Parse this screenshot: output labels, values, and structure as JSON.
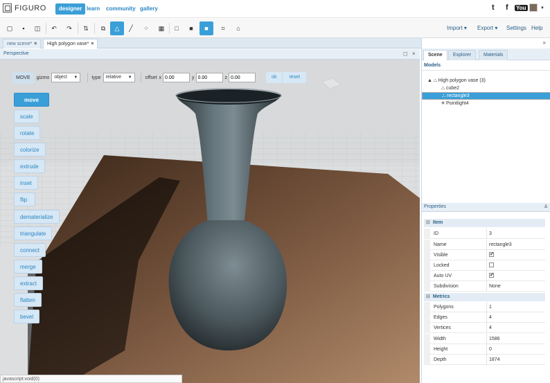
{
  "app": {
    "logo_text": "FIGURO",
    "nav": [
      {
        "label": "designer",
        "active": true
      },
      {
        "label": "learn",
        "active": false
      },
      {
        "label": "community",
        "active": false
      },
      {
        "label": "gallery",
        "active": false
      }
    ],
    "social": {
      "twitter": "t",
      "facebook": "f",
      "youtube": "You"
    }
  },
  "toolbar": {
    "tools": [
      "new-icon",
      "save-icon",
      "save-as-icon",
      "undo-icon",
      "redo-icon",
      "align-icon",
      "clone-icon",
      "vertex-mode-icon",
      "edge-mode-icon",
      "face-mode-icon",
      "checker-icon",
      "box-icon",
      "solid-icon",
      "fill-icon",
      "crop-icon",
      "render-icon"
    ],
    "menus": {
      "import": "Import",
      "export": "Export",
      "settings": "Settings",
      "help": "Help"
    }
  },
  "tabs": [
    {
      "label": "new scene*",
      "close": "×"
    },
    {
      "label": "High polygon vase*",
      "close": "×"
    }
  ],
  "perspective": {
    "title": "Perspective",
    "movebar": {
      "mode": "MOVE",
      "gizmo_label": "gizmo",
      "gizmo_value": "object",
      "type_label": "type",
      "type_value": "relative",
      "offset_label": "offset",
      "x_label": "x",
      "x_value": "0.00",
      "y_label": "y",
      "y_value": "0.00",
      "z_label": "z",
      "z_value": "0.00",
      "ok": "ok",
      "reset": "reset"
    },
    "tools": [
      "move",
      "scale",
      "rotate",
      "colorize",
      "extrude",
      "inset",
      "flip",
      "dematerialize",
      "triangulate",
      "connect",
      "merge",
      "extract",
      "flatten",
      "bevel"
    ]
  },
  "status": "javascript:void(0)",
  "right_panel": {
    "tabs": [
      "Scene",
      "Explorer",
      "Materials"
    ],
    "models_title": "Models",
    "tree": [
      {
        "label": "High polygon vase (3)",
        "icon": "▲ ⛬"
      },
      {
        "label": "cube2",
        "icon": "⛬"
      },
      {
        "label": "rectangle3",
        "icon": "⛬"
      },
      {
        "label": "Pointlight4",
        "icon": "✳"
      }
    ],
    "properties_title": "Properties",
    "item_group": "Item",
    "metrics_group": "Metrics",
    "props": {
      "id": {
        "k": "ID",
        "v": "3"
      },
      "name": {
        "k": "Name",
        "v": "rectangle3"
      },
      "visible": {
        "k": "Visible",
        "v": "✔"
      },
      "locked": {
        "k": "Locked",
        "v": ""
      },
      "autouv": {
        "k": "Auto UV",
        "v": "✔"
      },
      "subdivision": {
        "k": "Subdivision",
        "v": "None"
      },
      "polygons": {
        "k": "Polygons",
        "v": "1"
      },
      "edges": {
        "k": "Edges",
        "v": "4"
      },
      "vertices": {
        "k": "Vertices",
        "v": "4"
      },
      "width": {
        "k": "Width",
        "v": "1586"
      },
      "height": {
        "k": "Height",
        "v": "0"
      },
      "depth": {
        "k": "Depth",
        "v": "1874"
      }
    }
  }
}
